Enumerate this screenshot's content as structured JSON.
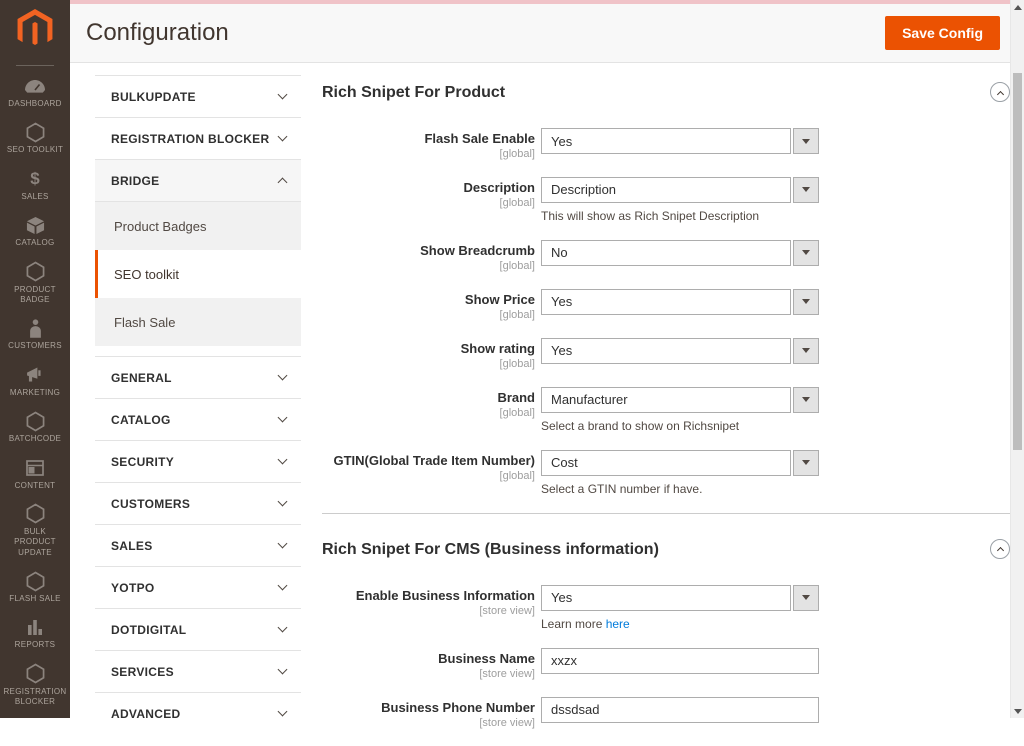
{
  "app": {
    "title": "Configuration",
    "save_button": "Save Config"
  },
  "colors": {
    "accent": "#eb5202",
    "sidebar_bg": "#41362f",
    "header_bg": "#f8f8f8",
    "top_strip": "#f0c3c8",
    "link": "#007bdb",
    "select_border": "#adadad"
  },
  "sidebar": {
    "items": [
      {
        "label": "DASHBOARD",
        "icon": "dashboard-icon"
      },
      {
        "label": "SEO TOOLKIT",
        "icon": "hexagon-icon"
      },
      {
        "label": "SALES",
        "icon": "dollar-icon"
      },
      {
        "label": "CATALOG",
        "icon": "cube-icon"
      },
      {
        "label": "PRODUCT BADGE",
        "icon": "hexagon-icon"
      },
      {
        "label": "CUSTOMERS",
        "icon": "person-icon"
      },
      {
        "label": "MARKETING",
        "icon": "megaphone-icon"
      },
      {
        "label": "BATCHCODE",
        "icon": "hexagon-icon"
      },
      {
        "label": "CONTENT",
        "icon": "layout-icon"
      },
      {
        "label": "BULK PRODUCT UPDATE",
        "icon": "hexagon-icon"
      },
      {
        "label": "FLASH SALE",
        "icon": "hexagon-icon"
      },
      {
        "label": "REPORTS",
        "icon": "bar-chart-icon"
      },
      {
        "label": "REGISTRATION BLOCKER",
        "icon": "hexagon-icon"
      }
    ]
  },
  "config_nav": {
    "sections": [
      {
        "label": "BULKUPDATE",
        "state": "collapsed"
      },
      {
        "label": "REGISTRATION BLOCKER",
        "state": "collapsed"
      },
      {
        "label": "BRIDGE",
        "state": "expanded",
        "children": [
          {
            "label": "Product Badges",
            "selected": false
          },
          {
            "label": "SEO toolkit",
            "selected": true
          },
          {
            "label": "Flash Sale",
            "selected": false
          }
        ]
      },
      {
        "label": "GENERAL",
        "state": "collapsed"
      },
      {
        "label": "CATALOG",
        "state": "collapsed"
      },
      {
        "label": "SECURITY",
        "state": "collapsed"
      },
      {
        "label": "CUSTOMERS",
        "state": "collapsed"
      },
      {
        "label": "SALES",
        "state": "collapsed"
      },
      {
        "label": "YOTPO",
        "state": "collapsed"
      },
      {
        "label": "DOTDIGITAL",
        "state": "collapsed"
      },
      {
        "label": "SERVICES",
        "state": "collapsed"
      },
      {
        "label": "ADVANCED",
        "state": "collapsed"
      }
    ]
  },
  "main": {
    "sections": [
      {
        "title": "Rich Snipet For Product",
        "fields": [
          {
            "label": "Flash Sale Enable",
            "scope": "[global]",
            "type": "select",
            "value": "Yes"
          },
          {
            "label": "Description",
            "scope": "[global]",
            "type": "select",
            "value": "Description",
            "note": "This will show as Rich Snipet Description"
          },
          {
            "label": "Show Breadcrumb",
            "scope": "[global]",
            "type": "select",
            "value": "No"
          },
          {
            "label": "Show Price",
            "scope": "[global]",
            "type": "select",
            "value": "Yes"
          },
          {
            "label": "Show rating",
            "scope": "[global]",
            "type": "select",
            "value": "Yes"
          },
          {
            "label": "Brand",
            "scope": "[global]",
            "type": "select",
            "value": "Manufacturer",
            "note": "Select a brand to show on Richsnipet"
          },
          {
            "label": "GTIN(Global Trade Item Number)",
            "scope": "[global]",
            "type": "select",
            "value": "Cost",
            "note": "Select a GTIN number if have."
          }
        ]
      },
      {
        "title": "Rich Snipet For CMS (Business information)",
        "fields": [
          {
            "label": "Enable Business Information",
            "scope": "[store view]",
            "type": "select",
            "value": "Yes",
            "note_prefix": "Learn more ",
            "note_link": "here"
          },
          {
            "label": "Business Name",
            "scope": "[store view]",
            "type": "text",
            "value": "xxzx"
          },
          {
            "label": "Business Phone Number",
            "scope": "[store view]",
            "type": "text",
            "value": "dssdsad"
          }
        ]
      }
    ]
  }
}
